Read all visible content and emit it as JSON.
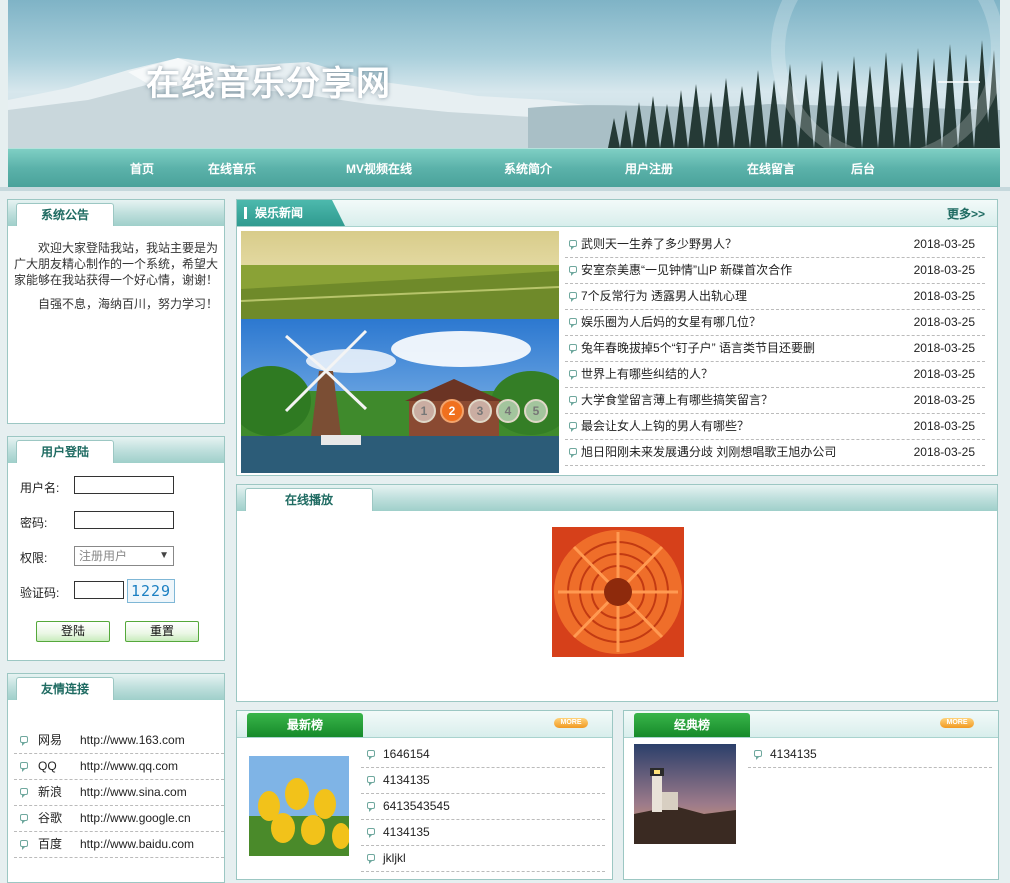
{
  "site": {
    "title": "在线音乐分享网"
  },
  "nav": {
    "items": [
      "首页",
      "在线音乐",
      "MV视频在线",
      "系统简介",
      "用户注册",
      "在线留言",
      "后台"
    ]
  },
  "notice": {
    "title": "系统公告",
    "paragraphs": [
      "欢迎大家登陆我站，我站主要是为广大朋友精心制作的一个系统，希望大家能够在我站获得一个好心情，谢谢！",
      "自强不息，海纳百川，努力学习！"
    ]
  },
  "login": {
    "title": "用户登陆",
    "username_label": "用户名:",
    "password_label": "密码:",
    "role_label": "权限:",
    "role_value": "注册用户",
    "captcha_label": "验证码:",
    "captcha_code": "1229",
    "login_button": "登陆",
    "reset_button": "重置"
  },
  "links": {
    "title": "友情连接",
    "items": [
      {
        "name": "网易",
        "url": "http://www.163.com"
      },
      {
        "name": "QQ",
        "url": "http://www.qq.com"
      },
      {
        "name": "新浪",
        "url": "http://www.sina.com"
      },
      {
        "name": "谷歌",
        "url": "http://www.google.cn"
      },
      {
        "name": "百度",
        "url": "http://www.baidu.com"
      }
    ]
  },
  "news": {
    "title": "娱乐新闻",
    "more": "更多>>",
    "slider_pages": [
      "1",
      "2",
      "3",
      "4",
      "5"
    ],
    "slider_active": 2,
    "items": [
      {
        "title": "武则天一生养了多少野男人？",
        "date": "2018-03-25"
      },
      {
        "title": "安室奈美惠“一见钟情”山P 新碟首次合作",
        "date": "2018-03-25"
      },
      {
        "title": "7个反常行为 透露男人出轨心理",
        "date": "2018-03-25"
      },
      {
        "title": "娱乐圈为人后妈的女星有哪几位？",
        "date": "2018-03-25"
      },
      {
        "title": "兔年春晚拔掉5个“钉子户” 语言类节目还要删",
        "date": "2018-03-25"
      },
      {
        "title": "世界上有哪些纠结的人？",
        "date": "2018-03-25"
      },
      {
        "title": "大学食堂留言薄上有哪些搞笑留言？",
        "date": "2018-03-25"
      },
      {
        "title": "最会让女人上钩的男人有哪些？",
        "date": "2018-03-25"
      },
      {
        "title": "旭日阳刚未来发展遇分歧 刘刚想唱歌王旭办公司",
        "date": "2018-03-25"
      }
    ]
  },
  "player": {
    "title": "在线播放"
  },
  "latest": {
    "title": "最新榜",
    "more": "MORE",
    "items": [
      "1646154",
      "4134135",
      "6413543545",
      "4134135",
      "jkljkl"
    ]
  },
  "classic": {
    "title": "经典榜",
    "more": "MORE",
    "items": [
      "4134135"
    ]
  }
}
